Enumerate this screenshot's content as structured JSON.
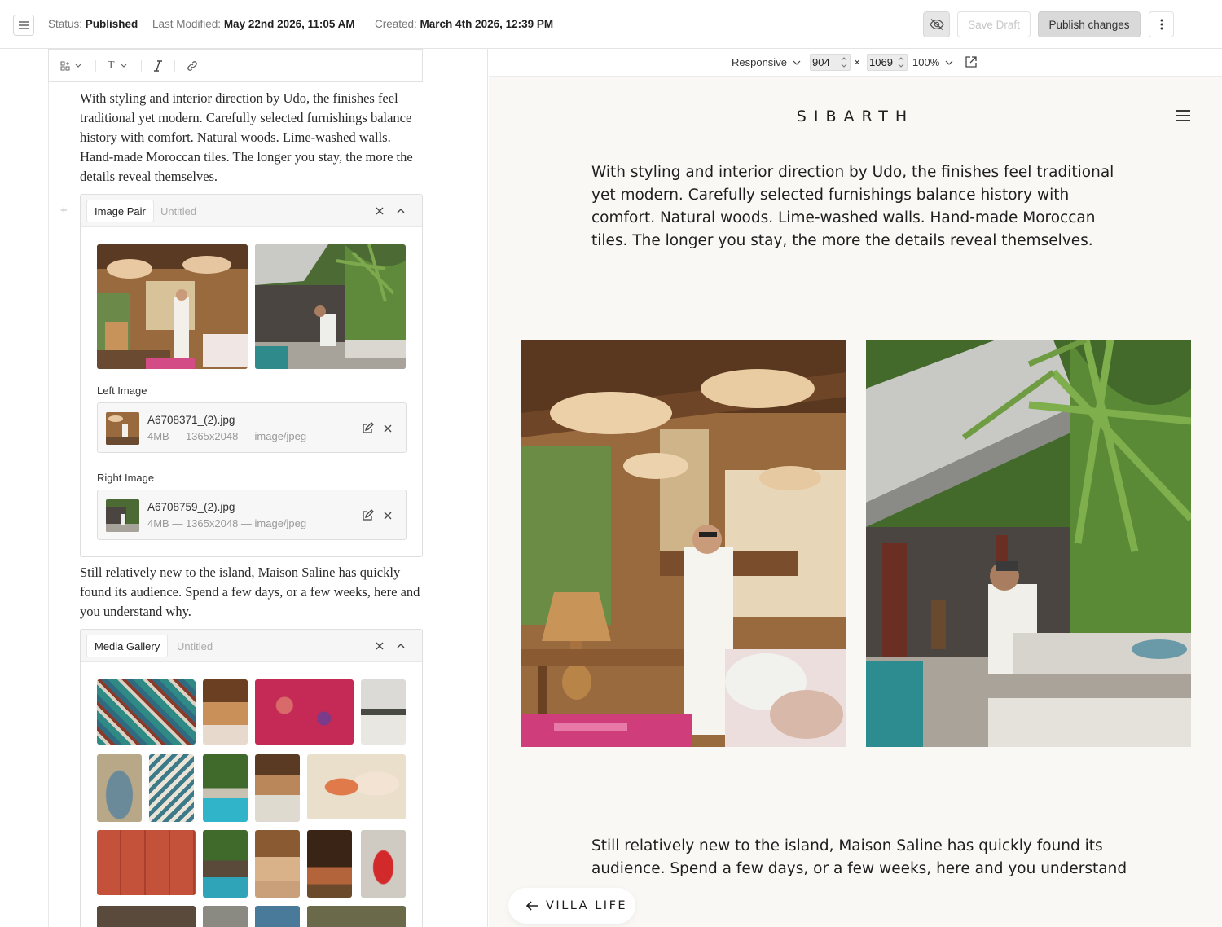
{
  "topbar": {
    "status_label": "Status:",
    "status_value": "Published",
    "modified_label": "Last Modified:",
    "modified_value": "May 22nd 2026, 11:05 AM",
    "created_label": "Created:",
    "created_value": "March 4th 2026, 12:39 PM",
    "save_label": "Save Draft",
    "publish_label": "Publish changes"
  },
  "editor": {
    "toolbar": {
      "text_style": "T"
    },
    "paragraph1": "With styling and interior direction by Udo, the finishes feel traditional yet modern. Carefully selected furnishings balance history with comfort. Natural woods. Lime-washed walls. Hand-made Moroccan tiles. The longer you stay, the more the details reveal themselves.",
    "image_pair": {
      "type_label": "Image Pair",
      "title": "Untitled",
      "left_label": "Left Image",
      "left_file": {
        "name": "A6708371_(2).jpg",
        "info": "4MB — 1365x2048 — image/jpeg"
      },
      "right_label": "Right Image",
      "right_file": {
        "name": "A6708759_(2).jpg",
        "info": "4MB — 1365x2048 — image/jpeg"
      }
    },
    "paragraph2": "Still relatively new to the island, Maison Saline has quickly found its audience. Spend a few days, or a few weeks, here and you understand why.",
    "media_gallery": {
      "type_label": "Media Gallery",
      "title": "Untitled"
    }
  },
  "preview_bar": {
    "mode": "Responsive",
    "width": "904",
    "height": "1069",
    "zoom": "100%"
  },
  "preview": {
    "logo": "SIBARTH",
    "paragraph1": "With styling and interior direction by Udo, the finishes feel traditional yet modern. Carefully selected furnishings balance history with comfort. Natural woods. Lime-washed walls. Hand-made Moroccan tiles. The longer you stay, the more the details reveal themselves.",
    "paragraph2": "Still relatively new to the island, Maison Saline has quickly found its audience. Spend a few days, or a few weeks, here and you understand",
    "back_label": "VILLA LIFE"
  },
  "colors": {
    "accent_wood": "#8a5a32",
    "preview_bg": "#faf8f5",
    "publish_bg": "#d9d9d9"
  }
}
